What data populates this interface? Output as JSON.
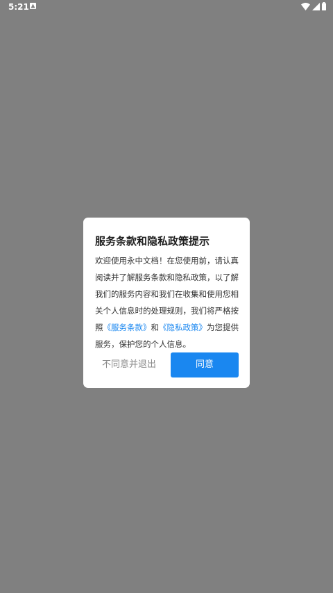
{
  "status_bar": {
    "time": "5:21",
    "icons": [
      "notification-icon",
      "wifi-icon",
      "signal-icon",
      "battery-icon"
    ]
  },
  "dialog": {
    "title": "服务条款和隐私政策提示",
    "body_intro": "欢迎使用永中文档！在您使用前，请认真阅读并了解服务条款和隐私政策，以了解我们的服务内容和我们在收集和使用您相关个人信息时的处理规则，我们将严格按照",
    "link_terms": "《服务条款》",
    "body_and": "和",
    "link_privacy": "《隐私政策》",
    "body_outro": "为您提供服务，保护您的个人信息。",
    "disagree_label": "不同意并退出",
    "agree_label": "同意"
  },
  "colors": {
    "overlay": "#808080",
    "accent": "#1a87f0",
    "dialog_bg": "#ffffff"
  }
}
